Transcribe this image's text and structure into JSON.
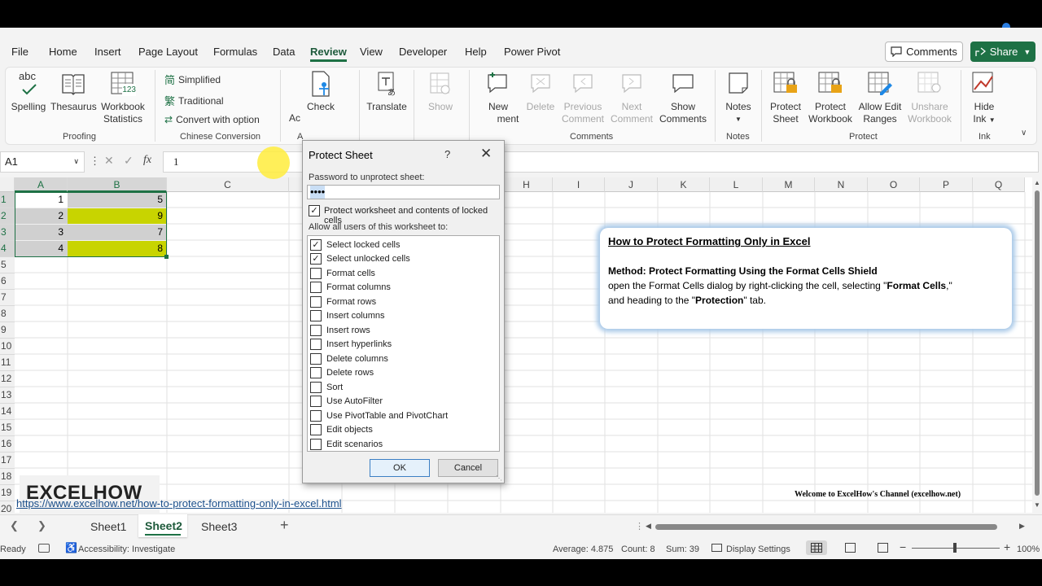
{
  "menu": {
    "tabs": [
      "File",
      "Home",
      "Insert",
      "Page Layout",
      "Formulas",
      "Data",
      "Review",
      "View",
      "Developer",
      "Help",
      "Power Pivot"
    ],
    "active": "Review",
    "comments_label": "Comments",
    "share_label": "Share"
  },
  "ribbon": {
    "proofing": {
      "label": "Proofing",
      "spelling": "Spelling",
      "thesaurus": "Thesaurus",
      "workbook_stats_1": "Workbook",
      "workbook_stats_2": "Statistics",
      "abc": "abc",
      "num": "123"
    },
    "chinese": {
      "label": "Chinese Conversion",
      "simplified": "Simplified",
      "traditional": "Traditional",
      "convert": "Convert with option"
    },
    "accessibility_partial": "Ac",
    "accessibility_group_partial": "A",
    "check": "Check",
    "translate": "Translate",
    "show": "Show",
    "comments": {
      "label": "Comments",
      "new_1": "New",
      "new_2": "ment",
      "delete": "Delete",
      "previous_1": "Previous",
      "previous_2": "Comment",
      "next_1": "Next",
      "next_2": "Comment",
      "show_1": "Show",
      "show_2": "Comments"
    },
    "notes": {
      "label": "Notes",
      "notes": "Notes"
    },
    "protect": {
      "label": "Protect",
      "protect_sheet_1": "Protect",
      "protect_sheet_2": "Sheet",
      "protect_workbook_1": "Protect",
      "protect_workbook_2": "Workbook",
      "allow_edit_1": "Allow Edit",
      "allow_edit_2": "Ranges",
      "unshare_1": "Unshare",
      "unshare_2": "Workbook"
    },
    "ink": {
      "label": "Ink",
      "hide_1": "Hide",
      "hide_2": "Ink"
    }
  },
  "formula_bar": {
    "name_box": "A1",
    "fx": "fx",
    "value": "1"
  },
  "grid": {
    "columns": [
      "A",
      "B",
      "C",
      "H",
      "I",
      "J",
      "K",
      "L",
      "M",
      "N",
      "O",
      "P",
      "Q"
    ],
    "rows": [
      "1",
      "2",
      "3",
      "4",
      "5",
      "6",
      "7",
      "8",
      "9",
      "10",
      "11",
      "12",
      "13",
      "14",
      "15",
      "16",
      "17",
      "18",
      "19",
      "20"
    ],
    "col_a_values": [
      "1",
      "2",
      "3",
      "4"
    ],
    "col_b_values": [
      "5",
      "9",
      "7",
      "8"
    ]
  },
  "note": {
    "title": "How to Protect Formatting Only in Excel",
    "method": "Method: Protect Formatting Using the Format Cells Shield",
    "body_1": "open the Format Cells dialog by right-clicking the cell, selecting \"",
    "body_bold_1": "Format Cells",
    "body_2": ",\"",
    "body_3": "and heading to the \"",
    "body_bold_2": "Protection",
    "body_4": "\" tab."
  },
  "watermark": {
    "logo": "EXCELHOW",
    "welcome": "Welcome to ExcelHow's  Channel (excelhow.net)",
    "link": "https://www.excelhow.net/how-to-protect-formatting-only-in-excel.html"
  },
  "dialog": {
    "title": "Protect Sheet",
    "help": "?",
    "password_label": "Password to unprotect sheet:",
    "password_value": "••••",
    "protect_contents": "Protect worksheet and contents of locked cells",
    "allow_label": "Allow all users of this worksheet to:",
    "options": [
      {
        "label": "Select locked cells",
        "checked": true
      },
      {
        "label": "Select unlocked cells",
        "checked": true
      },
      {
        "label": "Format cells",
        "checked": false
      },
      {
        "label": "Format columns",
        "checked": false
      },
      {
        "label": "Format rows",
        "checked": false
      },
      {
        "label": "Insert columns",
        "checked": false
      },
      {
        "label": "Insert rows",
        "checked": false
      },
      {
        "label": "Insert hyperlinks",
        "checked": false
      },
      {
        "label": "Delete columns",
        "checked": false
      },
      {
        "label": "Delete rows",
        "checked": false
      },
      {
        "label": "Sort",
        "checked": false
      },
      {
        "label": "Use AutoFilter",
        "checked": false
      },
      {
        "label": "Use PivotTable and PivotChart",
        "checked": false
      },
      {
        "label": "Edit objects",
        "checked": false
      },
      {
        "label": "Edit scenarios",
        "checked": false
      }
    ],
    "ok": "OK",
    "cancel": "Cancel"
  },
  "sheets": {
    "tabs": [
      "Sheet1",
      "Sheet2",
      "Sheet3"
    ],
    "active": "Sheet2",
    "add": "+"
  },
  "status": {
    "ready": "Ready",
    "accessibility": "Accessibility: Investigate",
    "average": "Average: 4.875",
    "count": "Count: 8",
    "sum": "Sum: 39",
    "display": "Display Settings",
    "zoom": "100%"
  },
  "colors": {
    "accent": "#1e7145",
    "yellow": "#c8d400",
    "selection": "#d0d0d0"
  }
}
